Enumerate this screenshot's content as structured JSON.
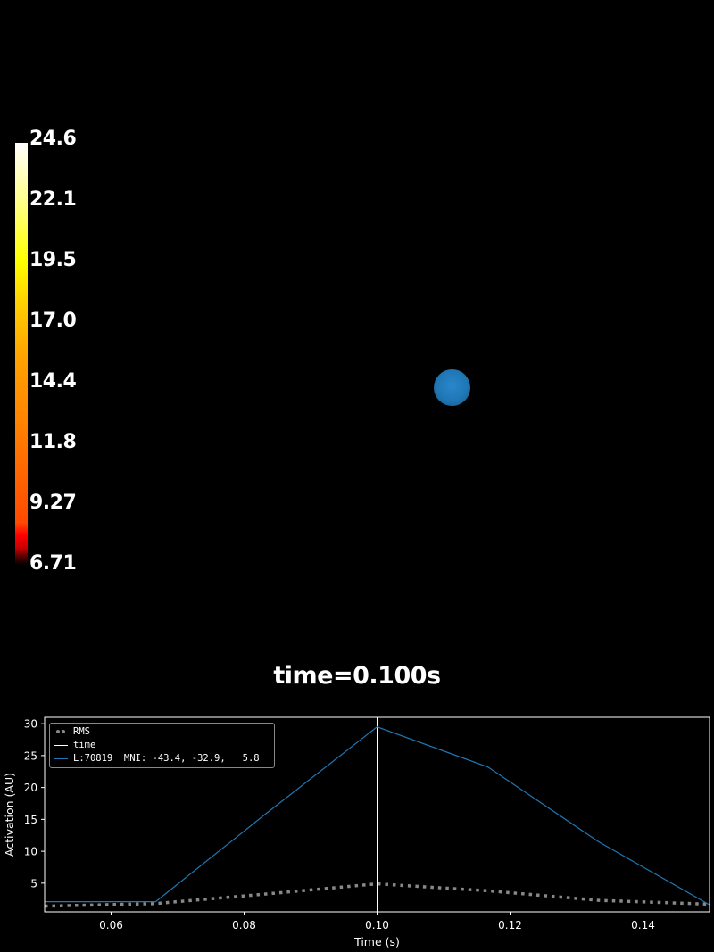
{
  "colorbar": {
    "labels": [
      "24.6",
      "22.1",
      "19.5",
      "17.0",
      "14.4",
      "11.8",
      "9.27",
      "6.71"
    ],
    "min": 6.71,
    "max": 24.6,
    "colormap": "hot"
  },
  "scene": {
    "title": "time=0.100s",
    "marker_color": "#1f77b4"
  },
  "chart_data": {
    "type": "line",
    "xlabel": "Time (s)",
    "ylabel": "Activation (AU)",
    "xlim": [
      0.05,
      0.15
    ],
    "ylim": [
      0.5,
      31
    ],
    "xticks": [
      "0.06",
      "0.08",
      "0.10",
      "0.12",
      "0.14"
    ],
    "xtick_values": [
      0.06,
      0.08,
      0.1,
      0.12,
      0.14
    ],
    "yticks": [
      "5",
      "10",
      "15",
      "20",
      "25",
      "30"
    ],
    "ytick_values": [
      5,
      10,
      15,
      20,
      25,
      30
    ],
    "time_marker": 0.1,
    "legend_position": "upper-left",
    "series": [
      {
        "name": "RMS",
        "style": "dotted",
        "color": "#888888",
        "x": [
          0.05,
          0.0667,
          0.0833,
          0.1,
          0.1167,
          0.1333,
          0.15
        ],
        "y": [
          1.4,
          1.8,
          3.3,
          4.9,
          3.8,
          2.3,
          1.7
        ]
      },
      {
        "name": "time",
        "style": "vline",
        "color": "#ffffff"
      },
      {
        "name": "L:70819  MNI: -43.4, -32.9,   5.8",
        "style": "solid",
        "color": "#1f77b4",
        "x": [
          0.05,
          0.0667,
          0.0833,
          0.1,
          0.1167,
          0.1333,
          0.15
        ],
        "y": [
          2.1,
          2.1,
          15.9,
          29.5,
          23.2,
          11.5,
          1.6
        ]
      }
    ]
  }
}
